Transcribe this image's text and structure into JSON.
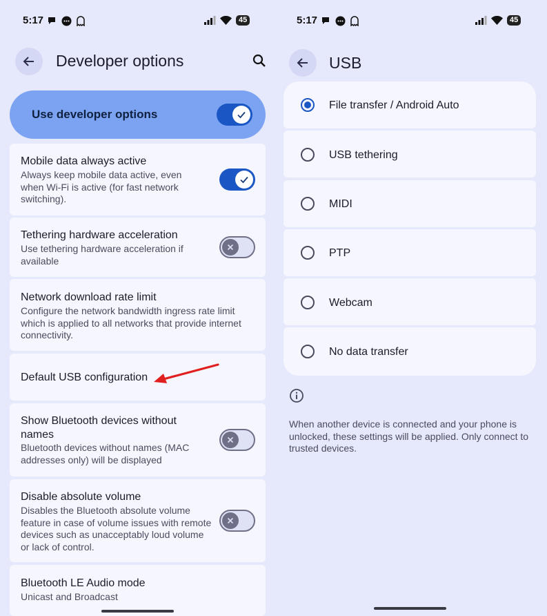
{
  "left": {
    "status": {
      "time": "5:17",
      "battery": "45"
    },
    "header": {
      "title": "Developer options"
    },
    "master": {
      "label": "Use developer options",
      "enabled": true
    },
    "settings": [
      {
        "title": "Mobile data always active",
        "subtitle": "Always keep mobile data active, even when Wi-Fi is active (for fast network switching).",
        "toggle": "on"
      },
      {
        "title": "Tethering hardware acceleration",
        "subtitle": "Use tethering hardware acceleration if available",
        "toggle": "off"
      },
      {
        "title": "Network download rate limit",
        "subtitle": "Configure the network bandwidth ingress rate limit which is applied to all networks that provide internet connectivity.",
        "toggle": "none"
      },
      {
        "title": "Default USB configuration",
        "subtitle": "",
        "toggle": "none"
      },
      {
        "title": "Show Bluetooth devices without names",
        "subtitle": "Bluetooth devices without names (MAC addresses only) will be displayed",
        "toggle": "off"
      },
      {
        "title": "Disable absolute volume",
        "subtitle": "Disables the Bluetooth absolute volume feature in case of volume issues with remote devices such as unacceptably loud volume or lack of control.",
        "toggle": "off"
      },
      {
        "title": "Bluetooth LE Audio mode",
        "subtitle": "Unicast and Broadcast",
        "toggle": "none"
      }
    ]
  },
  "right": {
    "status": {
      "time": "5:17",
      "battery": "45"
    },
    "header": {
      "title": "USB"
    },
    "options": [
      {
        "label": "File transfer / Android Auto",
        "selected": true
      },
      {
        "label": "USB tethering",
        "selected": false
      },
      {
        "label": "MIDI",
        "selected": false
      },
      {
        "label": "PTP",
        "selected": false
      },
      {
        "label": "Webcam",
        "selected": false
      },
      {
        "label": "No data transfer",
        "selected": false
      }
    ],
    "info": "When another device is connected and your phone is unlocked, these settings will be applied. Only connect to trusted devices."
  },
  "colors": {
    "background": "#e6e8fb",
    "card": "#f6f6fe",
    "accent": "#1a56c4",
    "master_toggle_bg": "#7ba3f2",
    "annotation_arrow": "#e0201e"
  }
}
